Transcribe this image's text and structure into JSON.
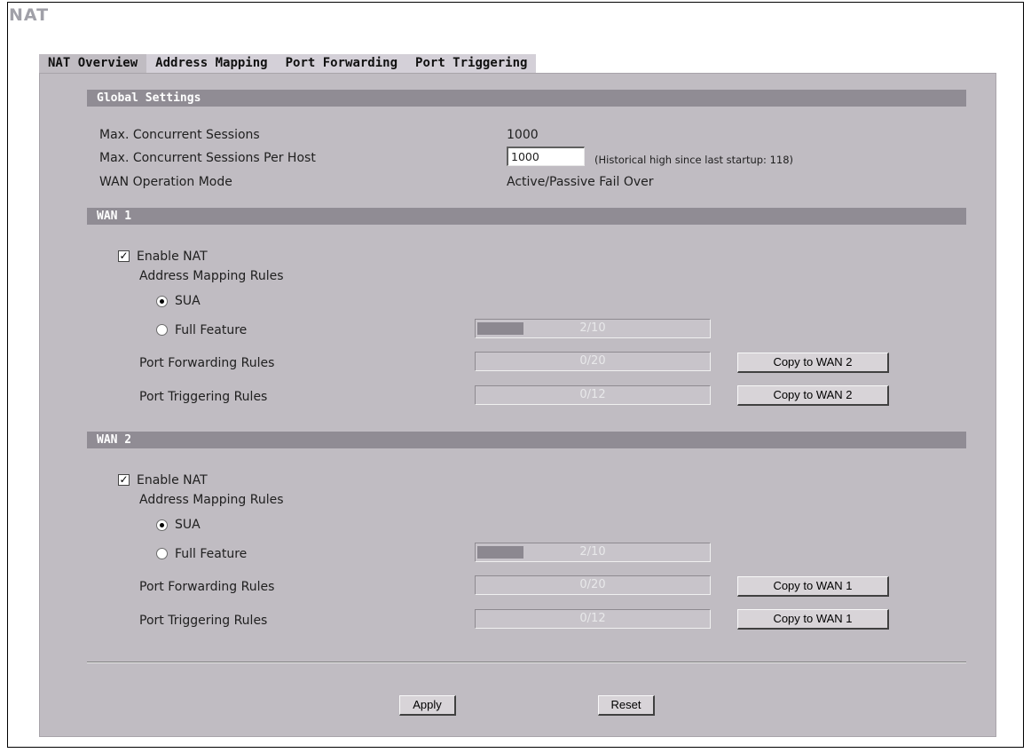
{
  "page": {
    "title": "NAT"
  },
  "tabs": [
    {
      "label": "NAT Overview",
      "active": true
    },
    {
      "label": "Address Mapping",
      "active": false
    },
    {
      "label": "Port Forwarding",
      "active": false
    },
    {
      "label": "Port Triggering",
      "active": false
    }
  ],
  "global": {
    "header": "Global Settings",
    "max_sessions_label": "Max. Concurrent Sessions",
    "max_sessions_value": "1000",
    "per_host_label": "Max. Concurrent Sessions Per Host",
    "per_host_value": "1000",
    "per_host_note": "(Historical high since last startup: 118)",
    "wan_mode_label": "WAN Operation Mode",
    "wan_mode_value": "Active/Passive Fail Over"
  },
  "wan1": {
    "header": "WAN 1",
    "enable_nat_label": "Enable NAT",
    "enable_nat_checked": true,
    "mapping_label": "Address Mapping Rules",
    "sua_label": "SUA",
    "full_feature_label": "Full Feature",
    "selected_mode": "SUA",
    "full_feature_usage": "2/10",
    "full_feature_fraction": 0.2,
    "port_fwd_label": "Port Forwarding Rules",
    "port_fwd_usage": "0/20",
    "port_fwd_fraction": 0,
    "port_trig_label": "Port Triggering Rules",
    "port_trig_usage": "0/12",
    "port_trig_fraction": 0,
    "copy_fwd_button": "Copy to WAN 2",
    "copy_trig_button": "Copy to WAN 2"
  },
  "wan2": {
    "header": "WAN 2",
    "enable_nat_label": "Enable NAT",
    "enable_nat_checked": true,
    "mapping_label": "Address Mapping Rules",
    "sua_label": "SUA",
    "full_feature_label": "Full Feature",
    "selected_mode": "SUA",
    "full_feature_usage": "2/10",
    "full_feature_fraction": 0.2,
    "port_fwd_label": "Port Forwarding Rules",
    "port_fwd_usage": "0/20",
    "port_fwd_fraction": 0,
    "port_trig_label": "Port Triggering Rules",
    "port_trig_usage": "0/12",
    "port_trig_fraction": 0,
    "copy_fwd_button": "Copy to WAN 1",
    "copy_trig_button": "Copy to WAN 1"
  },
  "actions": {
    "apply": "Apply",
    "reset": "Reset"
  }
}
